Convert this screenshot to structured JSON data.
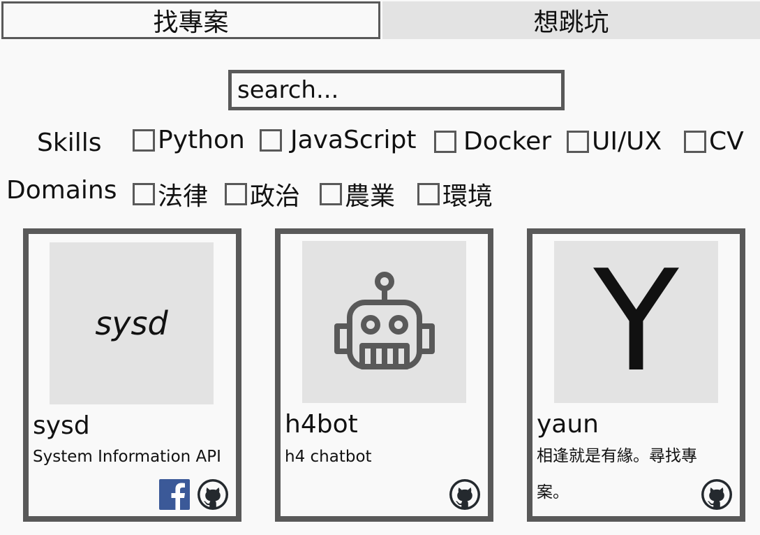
{
  "tabs": [
    {
      "label": "找專案",
      "active": true
    },
    {
      "label": "想跳坑",
      "active": false
    }
  ],
  "search": {
    "placeholder": "search..."
  },
  "filters": {
    "skills": {
      "label": "Skills",
      "options": [
        "Python",
        "JavaScript",
        "Docker",
        "UI/UX",
        "CV"
      ]
    },
    "domains": {
      "label": "Domains",
      "options": [
        "法律",
        "政治",
        "農業",
        "環境"
      ]
    }
  },
  "projects": [
    {
      "thumb_text": "sysd",
      "title": "sysd",
      "description": "System Information API",
      "links": [
        "facebook-icon",
        "github-icon"
      ]
    },
    {
      "thumb_icon": "robot-icon",
      "title": "h4bot",
      "description": "h4 chatbot",
      "links": [
        "github-icon"
      ]
    },
    {
      "thumb_text": "Y",
      "title": "yaun",
      "description": "相逢就是有緣。尋找專案。",
      "links": [
        "github-icon"
      ]
    }
  ],
  "colors": {
    "border": "#595959",
    "thumb_bg": "#e3e3e3",
    "facebook": "#3b5998",
    "github": "#24292e"
  }
}
